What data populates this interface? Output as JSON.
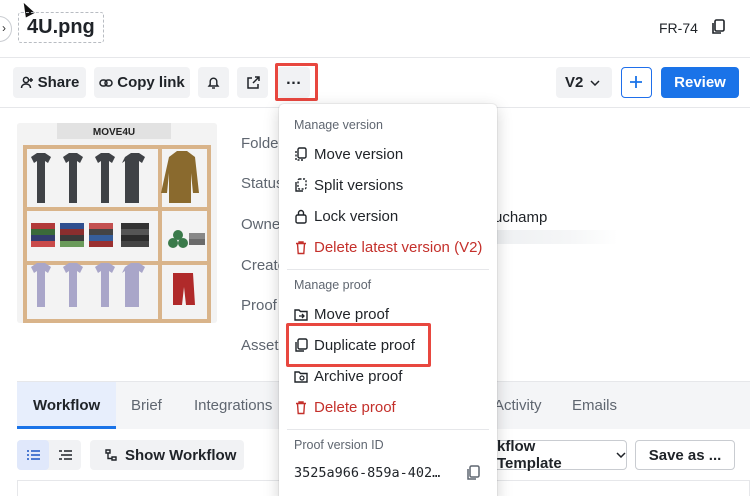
{
  "header": {
    "file_name": "4U.png",
    "doc_id": "FR-74"
  },
  "toolbar": {
    "share_label": "Share",
    "copy_link_label": "Copy link",
    "more_label": "…",
    "version_label": "V2",
    "review_label": "Review"
  },
  "thumbnail": {
    "brand_text": "MOVE4U"
  },
  "meta": {
    "folder_label": "Folde",
    "status_label": "Status",
    "owner_label": "Owne",
    "created_label": "Create",
    "proof_label": "Proof",
    "asset_label": "Asset",
    "owner_value_fragment": "uchamp"
  },
  "tabs": [
    {
      "label": "Workflow"
    },
    {
      "label": "Brief"
    },
    {
      "label": "Integrations"
    },
    {
      "label": "Activity"
    },
    {
      "label": "Emails"
    }
  ],
  "workflow_bar": {
    "show_workflow_label": "Show Workflow",
    "template_label": "kflow Template",
    "save_as_label": "Save as ..."
  },
  "menu": {
    "section_version": "Manage version",
    "move_version": "Move version",
    "split_versions": "Split versions",
    "lock_version": "Lock version",
    "delete_latest_version": "Delete latest version (V2)",
    "section_proof": "Manage proof",
    "move_proof": "Move proof",
    "duplicate_proof": "Duplicate proof",
    "archive_proof": "Archive proof",
    "delete_proof": "Delete proof",
    "section_proof_version_id": "Proof version ID",
    "proof_version_id": "3525a966-859a-402…"
  },
  "colors": {
    "accent": "#1a73e8",
    "danger": "#c4302b",
    "highlight": "#e8473f"
  }
}
